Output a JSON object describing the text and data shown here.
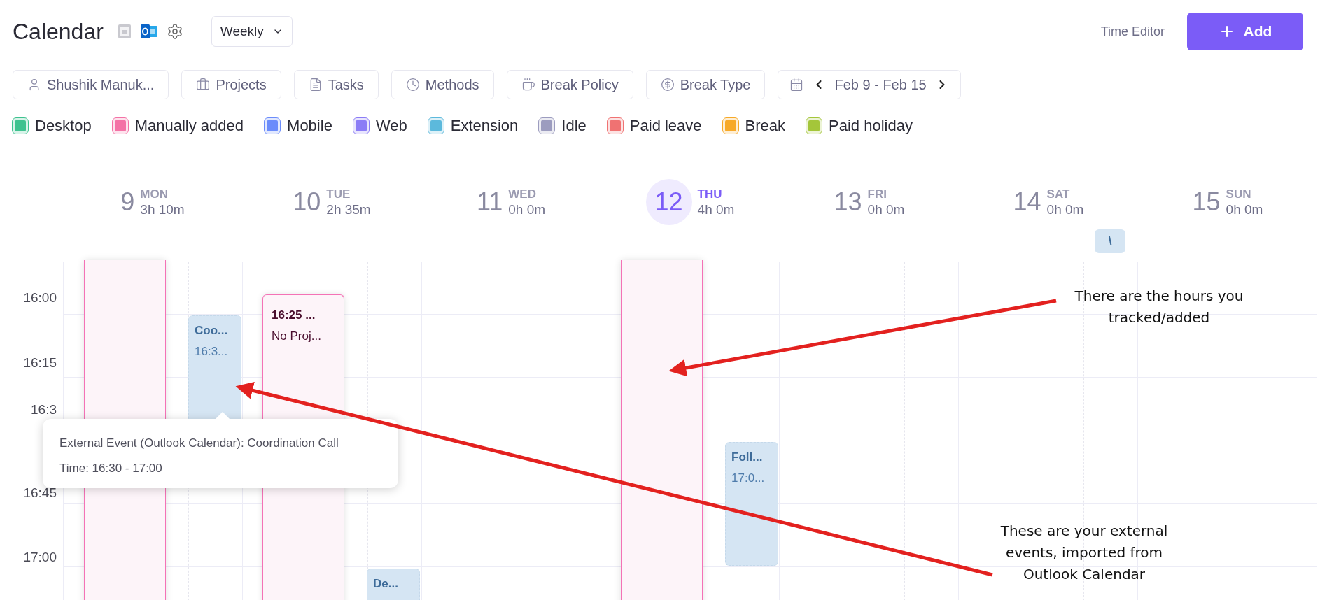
{
  "header": {
    "title": "Calendar",
    "view_select": {
      "value": "Weekly"
    },
    "time_editor": "Time Editor",
    "add_button": "Add"
  },
  "filters": [
    {
      "kind": "filter",
      "label": "Shushik Manuk..."
    },
    {
      "kind": "filter",
      "label": "Projects"
    },
    {
      "kind": "filter",
      "label": "Tasks"
    },
    {
      "kind": "filter",
      "label": "Methods"
    },
    {
      "kind": "filter",
      "label": "Break Policy"
    },
    {
      "kind": "filter",
      "label": "Break Type"
    },
    {
      "kind": "date_range",
      "label": "Feb 9 - Feb 15"
    }
  ],
  "legend": [
    {
      "label": "Desktop",
      "color": "#3ec28f"
    },
    {
      "label": "Manually added",
      "color": "#f472a6"
    },
    {
      "label": "Mobile",
      "color": "#6b8cfb"
    },
    {
      "label": "Web",
      "color": "#8b7cf6"
    },
    {
      "label": "Extension",
      "color": "#5cb9dc"
    },
    {
      "label": "Idle",
      "color": "#9c9cbf"
    },
    {
      "label": "Paid leave",
      "color": "#f07272"
    },
    {
      "label": "Break",
      "color": "#f7a928"
    },
    {
      "label": "Paid holiday",
      "color": "#a4c63a"
    }
  ],
  "days": [
    {
      "date": "9",
      "weekday": "MON",
      "total": "3h 10m",
      "selected": false
    },
    {
      "date": "10",
      "weekday": "TUE",
      "total": "2h 35m",
      "selected": false
    },
    {
      "date": "11",
      "weekday": "WED",
      "total": "0h 0m",
      "selected": false
    },
    {
      "date": "12",
      "weekday": "THU",
      "total": "4h 0m",
      "selected": true
    },
    {
      "date": "13",
      "weekday": "FRI",
      "total": "0h 0m",
      "selected": false
    },
    {
      "date": "14",
      "weekday": "SAT",
      "total": "0h 0m",
      "selected": false
    },
    {
      "date": "15",
      "weekday": "SUN",
      "total": "0h 0m",
      "selected": false
    }
  ],
  "day_marker": {
    "text": "\\"
  },
  "time_labels": [
    "16:00",
    "16:15",
    "16:3",
    "16:45",
    "17:00"
  ],
  "events": [
    {
      "kind": "tracked"
    },
    {
      "kind": "external",
      "title": "Coo...",
      "time": "16:3..."
    },
    {
      "kind": "tracked",
      "title": "16:25 ...",
      "time": "No Proj..."
    },
    {
      "kind": "external",
      "title": "De..."
    },
    {
      "kind": "tracked"
    },
    {
      "kind": "external",
      "title": "Foll...",
      "time": "17:0..."
    }
  ],
  "tooltip": {
    "lines": [
      "External Event (Outlook Calendar): Coordination Call",
      "Time: 16:30 - 17:00"
    ]
  },
  "annotations": [
    {
      "text": "There are the hours you tracked/added"
    },
    {
      "text": "These are your external events, imported from Outlook Calendar"
    }
  ]
}
